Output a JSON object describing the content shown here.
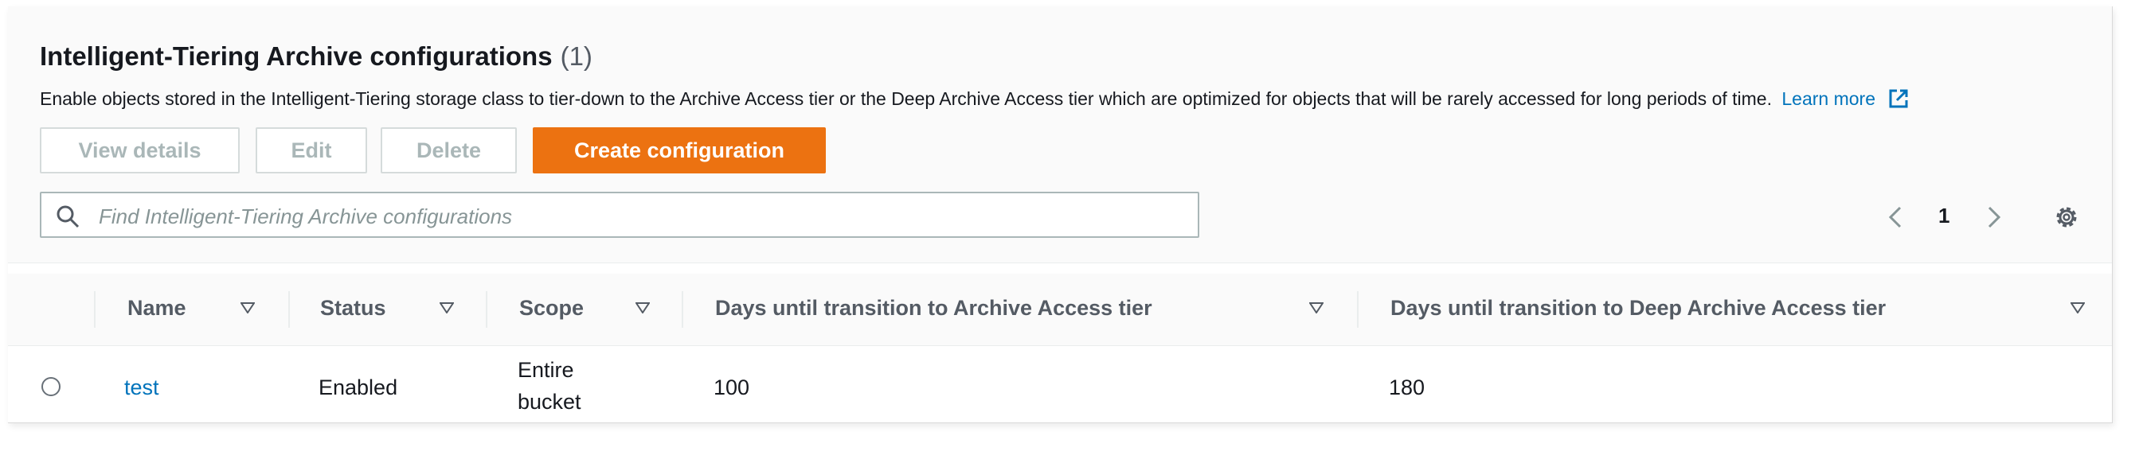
{
  "section": {
    "title": "Intelligent-Tiering Archive configurations",
    "count": "(1)",
    "description": "Enable objects stored in the Intelligent-Tiering storage class to tier-down to the Archive Access tier or the Deep Archive Access tier which are optimized for objects that will be rarely accessed for long periods of time.",
    "learn_more": "Learn more"
  },
  "toolbar": {
    "view_details": "View details",
    "edit": "Edit",
    "delete": "Delete",
    "create": "Create configuration"
  },
  "search": {
    "placeholder": "Find Intelligent-Tiering Archive configurations"
  },
  "pagination": {
    "current_page": "1"
  },
  "table": {
    "columns": [
      "Name",
      "Status",
      "Scope",
      "Days until transition to Archive Access tier",
      "Days until transition to Deep Archive Access tier"
    ],
    "rows": [
      {
        "name": "test",
        "status": "Enabled",
        "scope_line1": "Entire",
        "scope_line2": "bucket",
        "archive_days": "100",
        "deep_archive_days": "180"
      }
    ]
  },
  "colors": {
    "primary": "#ec7211",
    "link": "#0073bb"
  },
  "icons": [
    "external-link-icon",
    "search-icon",
    "chevron-left-icon",
    "chevron-right-icon",
    "gear-icon",
    "sort-icon"
  ]
}
